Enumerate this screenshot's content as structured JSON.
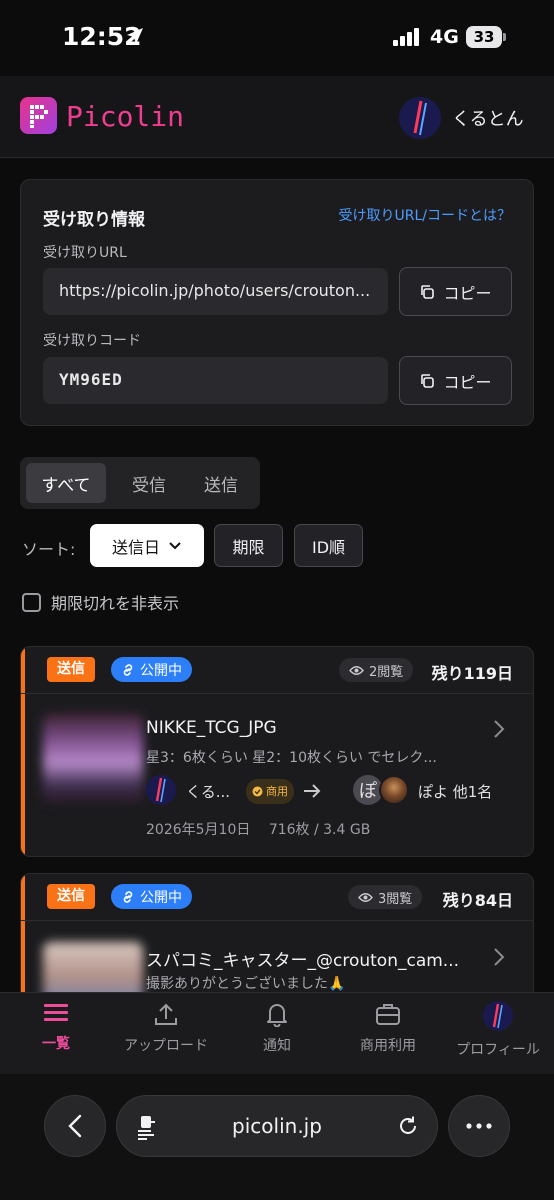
{
  "status_bar": {
    "time": "12:52",
    "network": "4G",
    "battery": "33"
  },
  "header": {
    "app_name": "Picolin",
    "user_name": "くるとん"
  },
  "receive_info": {
    "title": "受け取り情報",
    "help_link": "受け取りURL/コードとは？",
    "url_label": "受け取りURL",
    "url_value": "https://picolin.jp/photo/users/crouton...",
    "code_label": "受け取りコード",
    "code_value": "YM96ED",
    "copy_label": "コピー"
  },
  "tabs": [
    {
      "label": "すべて",
      "active": true
    },
    {
      "label": "受信",
      "active": false
    },
    {
      "label": "送信",
      "active": false
    }
  ],
  "sort": {
    "label": "ソート:",
    "selected": "送信日",
    "options": [
      "期限",
      "ID順"
    ]
  },
  "hide_expired_label": "期限切れを非表示",
  "transfers": [
    {
      "type_badge": "送信",
      "status_badge": "公開中",
      "views": "2閲覧",
      "remaining": "残り119日",
      "name": "NIKKE_TCG_JPG",
      "description": "星3：6枚くらい 星2：10枚くらい でセレク...",
      "sender_name": "くる...",
      "commercial_label": "商用",
      "recipient_initial": "ぽ",
      "recipients": "ぽよ 他1名",
      "date": "2026年5月10日",
      "size": "716枚 / 3.4 GB"
    },
    {
      "type_badge": "送信",
      "status_badge": "公開中",
      "views": "3閲覧",
      "remaining": "残り84日",
      "name": "スパコミ_キャスター_@crouton_cam...",
      "description": "撮影ありがとうございました🙏"
    }
  ],
  "bottom_nav": [
    {
      "label": "一覧",
      "icon": "list-icon",
      "active": true
    },
    {
      "label": "アップロード",
      "icon": "upload-icon",
      "active": false
    },
    {
      "label": "通知",
      "icon": "bell-icon",
      "active": false
    },
    {
      "label": "商用利用",
      "icon": "briefcase-icon",
      "active": false
    },
    {
      "label": "プロフィール",
      "icon": "profile-avatar",
      "active": false
    }
  ],
  "browser": {
    "url": "picolin.jp"
  },
  "colors": {
    "accent_pink": "#ee3d8f",
    "send_orange": "#f97316",
    "public_blue": "#2d7ff9",
    "link_blue": "#4c9dff"
  }
}
